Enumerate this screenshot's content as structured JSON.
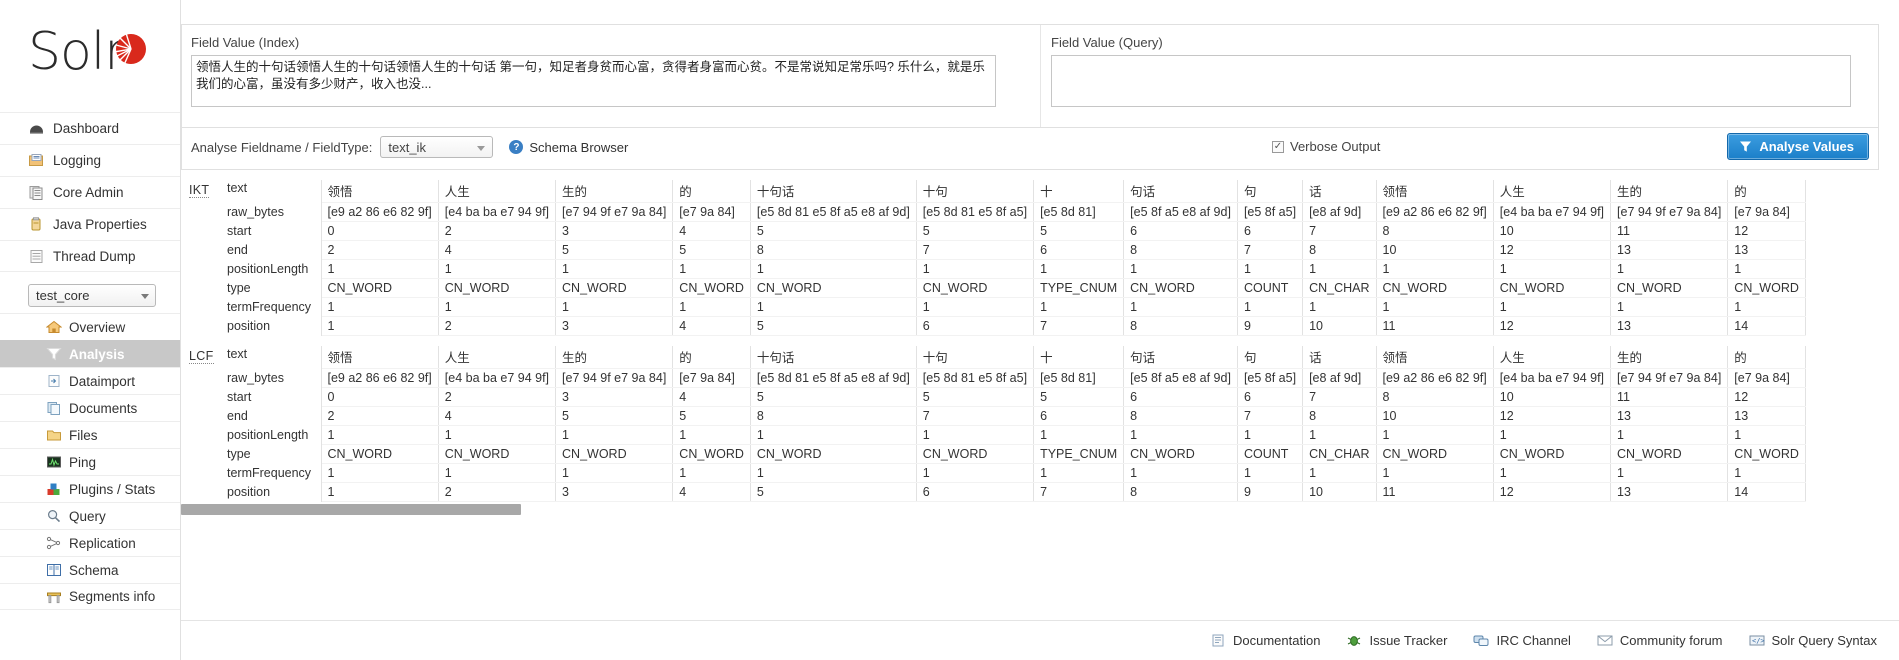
{
  "brand": {
    "name": "Solr",
    "logo_icon": "solr-sun-logo"
  },
  "sidebar": {
    "global_items": [
      {
        "label": "Dashboard",
        "icon": "dashboard-icon"
      },
      {
        "label": "Logging",
        "icon": "logging-icon"
      },
      {
        "label": "Core Admin",
        "icon": "core-admin-icon"
      },
      {
        "label": "Java Properties",
        "icon": "java-properties-icon"
      },
      {
        "label": "Thread Dump",
        "icon": "thread-dump-icon"
      }
    ],
    "core_selector": {
      "value": "test_core",
      "caret_icon": "chevron-down-icon"
    },
    "core_items": [
      {
        "label": "Overview",
        "icon": "home-icon",
        "active": false
      },
      {
        "label": "Analysis",
        "icon": "funnel-icon",
        "active": true
      },
      {
        "label": "Dataimport",
        "icon": "dataimport-icon",
        "active": false
      },
      {
        "label": "Documents",
        "icon": "documents-icon",
        "active": false
      },
      {
        "label": "Files",
        "icon": "folder-icon",
        "active": false
      },
      {
        "label": "Ping",
        "icon": "ping-icon",
        "active": false
      },
      {
        "label": "Plugins / Stats",
        "icon": "plugins-icon",
        "active": false
      },
      {
        "label": "Query",
        "icon": "magnifier-icon",
        "active": false
      },
      {
        "label": "Replication",
        "icon": "replication-icon",
        "active": false
      },
      {
        "label": "Schema",
        "icon": "book-icon",
        "active": false
      },
      {
        "label": "Segments info",
        "icon": "segments-icon",
        "active": false
      }
    ]
  },
  "form": {
    "index_label": "Field Value (Index)",
    "index_value": "领悟人生的十句话领悟人生的十句话领悟人生的十句话 第一句，知足者身贫而心富，贪得者身富而心贫。不是常说知足常乐吗? 乐什么，就是乐我们的心富，虽没有多少财产，收入也没...",
    "index_placeholder": "",
    "query_label": "Field Value (Query)",
    "query_value": "",
    "query_placeholder": "",
    "fieldname_label": "Analyse Fieldname / FieldType:",
    "fieldname_value": "text_ik",
    "schema_browser_label": "Schema Browser",
    "schema_browser_icon": "question-circle-icon",
    "verbose_label": "Verbose Output",
    "verbose_checked": true,
    "analyse_button_label": "Analyse Values",
    "analyse_button_icon": "funnel-icon",
    "analyse_button_color": "#1b7fc9"
  },
  "analysis": {
    "row_names": [
      "text",
      "raw_bytes",
      "start",
      "end",
      "positionLength",
      "type",
      "termFrequency",
      "position"
    ],
    "blocks": [
      {
        "label": "IKT",
        "tokens": [
          {
            "text": "领悟",
            "raw_bytes": "[e9 a2 86 e6 82 9f]",
            "start": "0",
            "end": "2",
            "positionLength": "1",
            "type": "CN_WORD",
            "termFrequency": "1",
            "position": "1"
          },
          {
            "text": "人生",
            "raw_bytes": "[e4 ba ba e7 94 9f]",
            "start": "2",
            "end": "4",
            "positionLength": "1",
            "type": "CN_WORD",
            "termFrequency": "1",
            "position": "2"
          },
          {
            "text": "生的",
            "raw_bytes": "[e7 94 9f e7 9a 84]",
            "start": "3",
            "end": "5",
            "positionLength": "1",
            "type": "CN_WORD",
            "termFrequency": "1",
            "position": "3"
          },
          {
            "text": "的",
            "raw_bytes": "[e7 9a 84]",
            "start": "4",
            "end": "5",
            "positionLength": "1",
            "type": "CN_WORD",
            "termFrequency": "1",
            "position": "4"
          },
          {
            "text": "十句话",
            "raw_bytes": "[e5 8d 81 e5 8f a5 e8 af 9d]",
            "start": "5",
            "end": "8",
            "positionLength": "1",
            "type": "CN_WORD",
            "termFrequency": "1",
            "position": "5"
          },
          {
            "text": "十句",
            "raw_bytes": "[e5 8d 81 e5 8f a5]",
            "start": "5",
            "end": "7",
            "positionLength": "1",
            "type": "CN_WORD",
            "termFrequency": "1",
            "position": "6"
          },
          {
            "text": "十",
            "raw_bytes": "[e5 8d 81]",
            "start": "5",
            "end": "6",
            "positionLength": "1",
            "type": "TYPE_CNUM",
            "termFrequency": "1",
            "position": "7"
          },
          {
            "text": "句话",
            "raw_bytes": "[e5 8f a5 e8 af 9d]",
            "start": "6",
            "end": "8",
            "positionLength": "1",
            "type": "CN_WORD",
            "termFrequency": "1",
            "position": "8"
          },
          {
            "text": "句",
            "raw_bytes": "[e5 8f a5]",
            "start": "6",
            "end": "7",
            "positionLength": "1",
            "type": "COUNT",
            "termFrequency": "1",
            "position": "9"
          },
          {
            "text": "话",
            "raw_bytes": "[e8 af 9d]",
            "start": "7",
            "end": "8",
            "positionLength": "1",
            "type": "CN_CHAR",
            "termFrequency": "1",
            "position": "10"
          },
          {
            "text": "领悟",
            "raw_bytes": "[e9 a2 86 e6 82 9f]",
            "start": "8",
            "end": "10",
            "positionLength": "1",
            "type": "CN_WORD",
            "termFrequency": "1",
            "position": "11"
          },
          {
            "text": "人生",
            "raw_bytes": "[e4 ba ba e7 94 9f]",
            "start": "10",
            "end": "12",
            "positionLength": "1",
            "type": "CN_WORD",
            "termFrequency": "1",
            "position": "12"
          },
          {
            "text": "生的",
            "raw_bytes": "[e7 94 9f e7 9a 84]",
            "start": "11",
            "end": "13",
            "positionLength": "1",
            "type": "CN_WORD",
            "termFrequency": "1",
            "position": "13"
          },
          {
            "text": "的",
            "raw_bytes": "[e7 9a 84]",
            "start": "12",
            "end": "13",
            "positionLength": "1",
            "type": "CN_WORD",
            "termFrequency": "1",
            "position": "14"
          }
        ]
      },
      {
        "label": "LCF",
        "tokens": [
          {
            "text": "领悟",
            "raw_bytes": "[e9 a2 86 e6 82 9f]",
            "start": "0",
            "end": "2",
            "positionLength": "1",
            "type": "CN_WORD",
            "termFrequency": "1",
            "position": "1"
          },
          {
            "text": "人生",
            "raw_bytes": "[e4 ba ba e7 94 9f]",
            "start": "2",
            "end": "4",
            "positionLength": "1",
            "type": "CN_WORD",
            "termFrequency": "1",
            "position": "2"
          },
          {
            "text": "生的",
            "raw_bytes": "[e7 94 9f e7 9a 84]",
            "start": "3",
            "end": "5",
            "positionLength": "1",
            "type": "CN_WORD",
            "termFrequency": "1",
            "position": "3"
          },
          {
            "text": "的",
            "raw_bytes": "[e7 9a 84]",
            "start": "4",
            "end": "5",
            "positionLength": "1",
            "type": "CN_WORD",
            "termFrequency": "1",
            "position": "4"
          },
          {
            "text": "十句话",
            "raw_bytes": "[e5 8d 81 e5 8f a5 e8 af 9d]",
            "start": "5",
            "end": "8",
            "positionLength": "1",
            "type": "CN_WORD",
            "termFrequency": "1",
            "position": "5"
          },
          {
            "text": "十句",
            "raw_bytes": "[e5 8d 81 e5 8f a5]",
            "start": "5",
            "end": "7",
            "positionLength": "1",
            "type": "CN_WORD",
            "termFrequency": "1",
            "position": "6"
          },
          {
            "text": "十",
            "raw_bytes": "[e5 8d 81]",
            "start": "5",
            "end": "6",
            "positionLength": "1",
            "type": "TYPE_CNUM",
            "termFrequency": "1",
            "position": "7"
          },
          {
            "text": "句话",
            "raw_bytes": "[e5 8f a5 e8 af 9d]",
            "start": "6",
            "end": "8",
            "positionLength": "1",
            "type": "CN_WORD",
            "termFrequency": "1",
            "position": "8"
          },
          {
            "text": "句",
            "raw_bytes": "[e5 8f a5]",
            "start": "6",
            "end": "7",
            "positionLength": "1",
            "type": "COUNT",
            "termFrequency": "1",
            "position": "9"
          },
          {
            "text": "话",
            "raw_bytes": "[e8 af 9d]",
            "start": "7",
            "end": "8",
            "positionLength": "1",
            "type": "CN_CHAR",
            "termFrequency": "1",
            "position": "10"
          },
          {
            "text": "领悟",
            "raw_bytes": "[e9 a2 86 e6 82 9f]",
            "start": "8",
            "end": "10",
            "positionLength": "1",
            "type": "CN_WORD",
            "termFrequency": "1",
            "position": "11"
          },
          {
            "text": "人生",
            "raw_bytes": "[e4 ba ba e7 94 9f]",
            "start": "10",
            "end": "12",
            "positionLength": "1",
            "type": "CN_WORD",
            "termFrequency": "1",
            "position": "12"
          },
          {
            "text": "生的",
            "raw_bytes": "[e7 94 9f e7 9a 84]",
            "start": "11",
            "end": "13",
            "positionLength": "1",
            "type": "CN_WORD",
            "termFrequency": "1",
            "position": "13"
          },
          {
            "text": "的",
            "raw_bytes": "[e7 9a 84]",
            "start": "12",
            "end": "13",
            "positionLength": "1",
            "type": "CN_WORD",
            "termFrequency": "1",
            "position": "14"
          }
        ]
      }
    ]
  },
  "footer": {
    "links": [
      {
        "label": "Documentation",
        "icon": "document-icon"
      },
      {
        "label": "Issue Tracker",
        "icon": "bug-icon"
      },
      {
        "label": "IRC Channel",
        "icon": "chat-icon"
      },
      {
        "label": "Community forum",
        "icon": "mail-icon"
      },
      {
        "label": "Solr Query Syntax",
        "icon": "syntax-icon"
      }
    ]
  }
}
